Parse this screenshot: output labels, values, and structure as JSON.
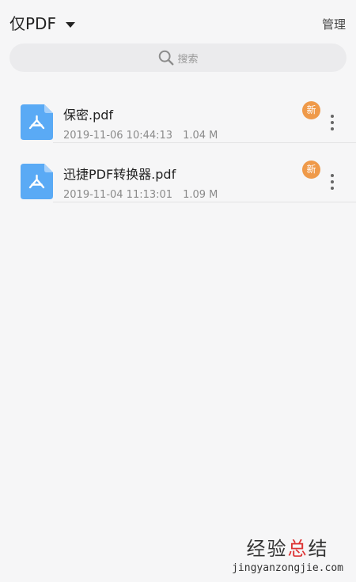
{
  "header": {
    "filter_label": "仅PDF",
    "manage_label": "管理"
  },
  "search": {
    "placeholder": "搜索"
  },
  "files": [
    {
      "name": "保密.pdf",
      "date": "2019-11-06 10:44:13",
      "size": "1.04 M",
      "badge": "新"
    },
    {
      "name": "迅捷PDF转换器.pdf",
      "date": "2019-11-04 11:13:01",
      "size": "1.09 M",
      "badge": "新"
    }
  ],
  "watermark": {
    "text_part1": "经验",
    "text_part2": "总",
    "text_part3": "结",
    "url": "jingyanzongjie.com"
  },
  "colors": {
    "background": "#f6f6f7",
    "file_icon": "#5aaaf5",
    "badge": "#ef9a4a",
    "divider": "#e2e2e4"
  },
  "icons": {
    "file": "pdf-file-icon",
    "search": "search-icon",
    "more": "more-vertical-icon",
    "caret": "caret-down-icon"
  }
}
